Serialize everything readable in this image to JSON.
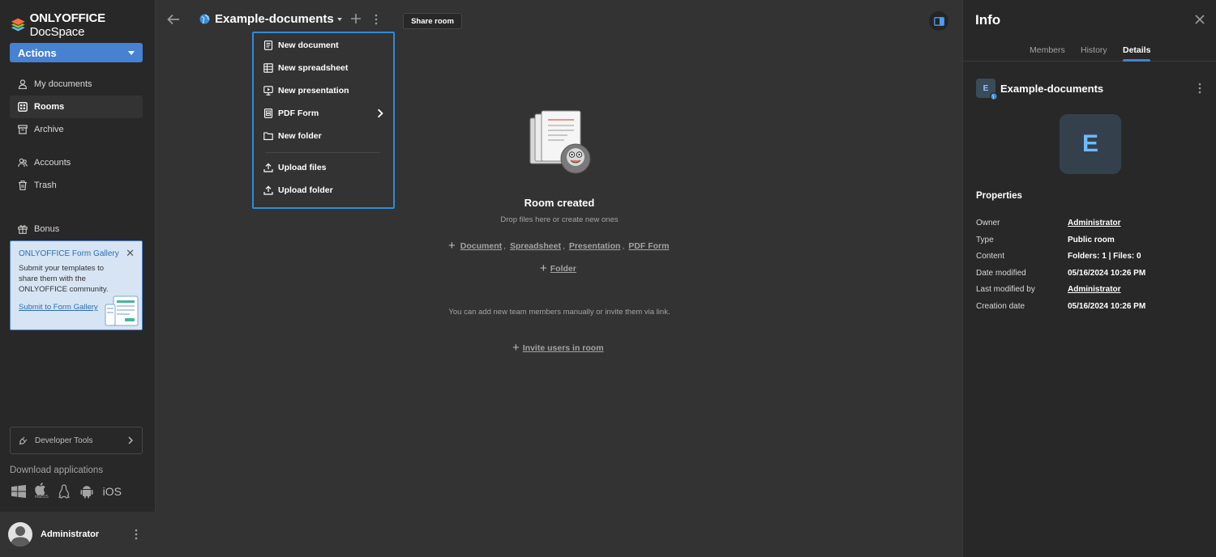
{
  "app": {
    "brand_bold": "ONLYOFFICE",
    "brand_light": " DocSpace"
  },
  "sidebar": {
    "actions_label": "Actions",
    "items": [
      {
        "label": "My documents",
        "icon": "user-icon"
      },
      {
        "label": "Rooms",
        "icon": "rooms-icon",
        "active": true
      },
      {
        "label": "Archive",
        "icon": "archive-icon"
      },
      {
        "label": "Accounts",
        "icon": "accounts-icon"
      },
      {
        "label": "Trash",
        "icon": "trash-icon"
      },
      {
        "label": "Bonus",
        "icon": "bonus-icon"
      }
    ],
    "gallery": {
      "title": "ONLYOFFICE Form Gallery",
      "text": "Submit your templates to share them with the ONLYOFFICE community.",
      "link": "Submit to Form Gallery"
    },
    "dev_tools_label": "Developer Tools",
    "download_title": "Download applications",
    "download_ios": "iOS",
    "download_macos": "macOS",
    "user_name": "Administrator"
  },
  "header": {
    "room_title": "Example-documents",
    "share_label": "Share room"
  },
  "dropdown": {
    "items": [
      {
        "label": "New document"
      },
      {
        "label": "New spreadsheet"
      },
      {
        "label": "New presentation"
      },
      {
        "label": "PDF Form"
      },
      {
        "label": "New folder"
      },
      {
        "label": "Upload files"
      },
      {
        "label": "Upload folder"
      }
    ]
  },
  "empty": {
    "title": "Room created",
    "subtitle": "Drop files here or create new ones",
    "link_document": "Document",
    "link_spreadsheet": "Spreadsheet",
    "link_presentation": "Presentation",
    "link_pdf": "PDF Form",
    "link_folder": "Folder",
    "invite_text": "You can add new team members manually or invite them via link.",
    "invite_link": "Invite users in room"
  },
  "info": {
    "title": "Info",
    "tabs": [
      "Members",
      "History",
      "Details"
    ],
    "active_tab": "Details",
    "room_initial": "E",
    "room_name": "Example-documents",
    "properties_title": "Properties",
    "properties": [
      {
        "key": "Owner",
        "value": "Administrator",
        "link": true
      },
      {
        "key": "Type",
        "value": "Public room",
        "link": false
      },
      {
        "key": "Content",
        "value": "Folders: 1 | Files: 0",
        "link": false
      },
      {
        "key": "Date modified",
        "value": "05/16/2024 10:26 PM",
        "link": false
      },
      {
        "key": "Last modified by",
        "value": "Administrator",
        "link": true
      },
      {
        "key": "Creation date",
        "value": "05/16/2024 10:26 PM",
        "link": false
      }
    ]
  },
  "colors": {
    "accent": "#4781d1",
    "dropdown_border": "#2f8bd8",
    "background": "#333333",
    "sidebar": "#282828"
  }
}
